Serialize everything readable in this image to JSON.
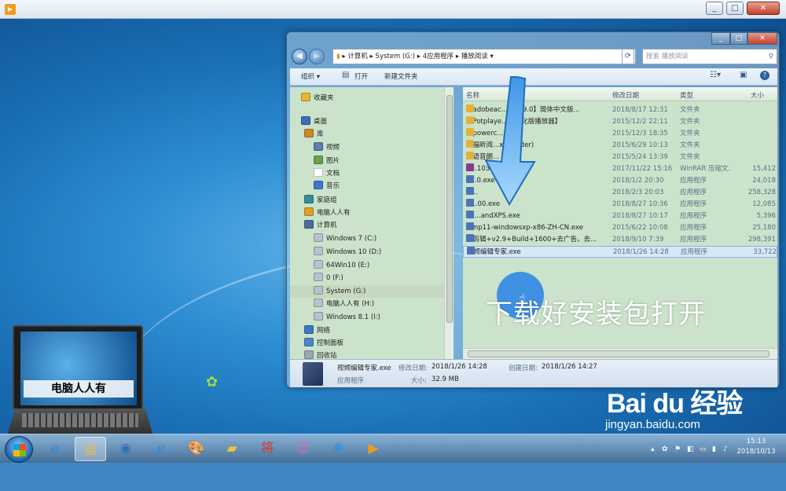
{
  "colors": {
    "accent": "#2f6eb4",
    "overlay_text": "#ffffff",
    "pane_bg": "#cbe3cb",
    "selection": "#d6e7f8"
  },
  "outer_window": {
    "icon": "video-player-icon",
    "controls": [
      "_",
      "□",
      "✕"
    ]
  },
  "explorer": {
    "controls": [
      "_",
      "□",
      "✕"
    ],
    "address": {
      "back": "back-arrow-icon",
      "forward": "forward-arrow-icon",
      "path": [
        "计算机",
        "System (G:)",
        "4应用程序",
        "播放阅读"
      ],
      "search_placeholder": "搜索 播放阅读"
    },
    "toolbar": {
      "organize": "组织 ▾",
      "open": "打开",
      "new_folder": "新建文件夹"
    },
    "nav": [
      {
        "label": "收藏夹",
        "icon": "star-icon",
        "indent": 0
      },
      {
        "label": "桌面",
        "icon": "desktop-icon",
        "indent": 0
      },
      {
        "label": "库",
        "icon": "library-icon",
        "indent": 1
      },
      {
        "label": "视频",
        "icon": "video-icon",
        "indent": 2
      },
      {
        "label": "图片",
        "icon": "picture-icon",
        "indent": 2
      },
      {
        "label": "文档",
        "icon": "document-icon",
        "indent": 2
      },
      {
        "label": "音乐",
        "icon": "music-icon",
        "indent": 2
      },
      {
        "label": "家庭组",
        "icon": "homegroup-icon",
        "indent": 1
      },
      {
        "label": "电脑人人有",
        "icon": "user-folder-icon",
        "indent": 1
      },
      {
        "label": "计算机",
        "icon": "computer-icon",
        "indent": 1
      },
      {
        "label": "Windows 7 (C:)",
        "icon": "drive-icon",
        "indent": 2
      },
      {
        "label": "Windows 10 (D:)",
        "icon": "drive-icon",
        "indent": 2
      },
      {
        "label": "64Win10 (E:)",
        "icon": "drive-icon",
        "indent": 2
      },
      {
        "label": "0 (F:)",
        "icon": "drive-icon",
        "indent": 2
      },
      {
        "label": "System (G:)",
        "icon": "drive-icon",
        "indent": 2,
        "selected": true
      },
      {
        "label": "电脑人人有 (H:)",
        "icon": "drive-icon",
        "indent": 2
      },
      {
        "label": "Windows 8.1 (I:)",
        "icon": "drive-icon",
        "indent": 2
      },
      {
        "label": "网络",
        "icon": "network-icon",
        "indent": 1
      },
      {
        "label": "控制面板",
        "icon": "control-panel-icon",
        "indent": 1
      },
      {
        "label": "回收站",
        "icon": "recycle-bin-icon",
        "indent": 1
      }
    ],
    "columns": {
      "name": "名称",
      "date": "修改日期",
      "type": "类型",
      "size": "大小"
    },
    "files": [
      {
        "name": "【adobeac...prov9.0】简体中文版...",
        "date": "2018/8/17 12:31",
        "type": "文件夹",
        "size": "",
        "kind": "folder"
      },
      {
        "name": "【Potplaye...】汉化版播放器】",
        "date": "2015/12/2 22:11",
        "type": "文件夹",
        "size": "",
        "kind": "folder"
      },
      {
        "name": "【powerc...",
        "date": "2015/12/3 18:35",
        "type": "文件夹",
        "size": "",
        "kind": "folder"
      },
      {
        "name": "【福昕阅...xitReader)",
        "date": "2015/6/29 10:13",
        "type": "文件夹",
        "size": "",
        "kind": "folder"
      },
      {
        "name": "【语音朗...",
        "date": "2015/5/24 13:39",
        "type": "文件夹",
        "size": "",
        "kind": "folder"
      },
      {
        "name": "B...1035.7z",
        "date": "2017/11/22 15:16",
        "type": "WinRAR 压缩文...",
        "size": "15,412",
        "kind": "archive"
      },
      {
        "name": "E...0.exe",
        "date": "2018/1/2 20:30",
        "type": "应用程序",
        "size": "24,018",
        "kind": "exe"
      },
      {
        "name": "iT...",
        "date": "2018/2/3 20:03",
        "type": "应用程序",
        "size": "258,328",
        "kind": "exe"
      },
      {
        "name": "O...00.exe",
        "date": "2018/8/27 10:36",
        "type": "应用程序",
        "size": "12,085",
        "kind": "exe"
      },
      {
        "name": "Sa...andXPS.exe",
        "date": "2018/8/27 10:17",
        "type": "应用程序",
        "size": "5,396",
        "kind": "exe"
      },
      {
        "name": "wmp11-windowsxp-x86-ZH-CN.exe",
        "date": "2015/6/22 10:08",
        "type": "应用程序",
        "size": "25,180",
        "kind": "exe"
      },
      {
        "name": "爱剪辑+v2.9+Build+1600+去广告，去...",
        "date": "2018/9/10 7:39",
        "type": "应用程序",
        "size": "298,391",
        "kind": "exe"
      },
      {
        "name": "视频编辑专家.exe",
        "date": "2018/1/26 14:28",
        "type": "应用程序",
        "size": "33,722",
        "kind": "exe",
        "selected": true
      }
    ],
    "details": {
      "filename": "视频编辑专家.exe",
      "modified_label": "修改日期:",
      "modified": "2018/1/26 14:28",
      "created_label": "创建日期:",
      "created": "2018/1/26 14:27",
      "kind": "应用程序",
      "size_label": "大小:",
      "size": "32.9 MB"
    }
  },
  "overlay_caption": "下载好安装包打开",
  "laptop_label": "电脑人人有",
  "watermark": {
    "brand": "Bai du 经验",
    "url": "jingyan.baidu.com"
  },
  "taskbar": {
    "apps": [
      "ie-icon",
      "file-explorer-icon",
      "media-center-icon",
      "ie-icon",
      "paint-icon",
      "folder-icon",
      "jiang-app-icon",
      "game-icon",
      "settings-app-icon",
      "video-player-icon"
    ],
    "clock_time": "15:13",
    "clock_date": "2018/10/13"
  }
}
